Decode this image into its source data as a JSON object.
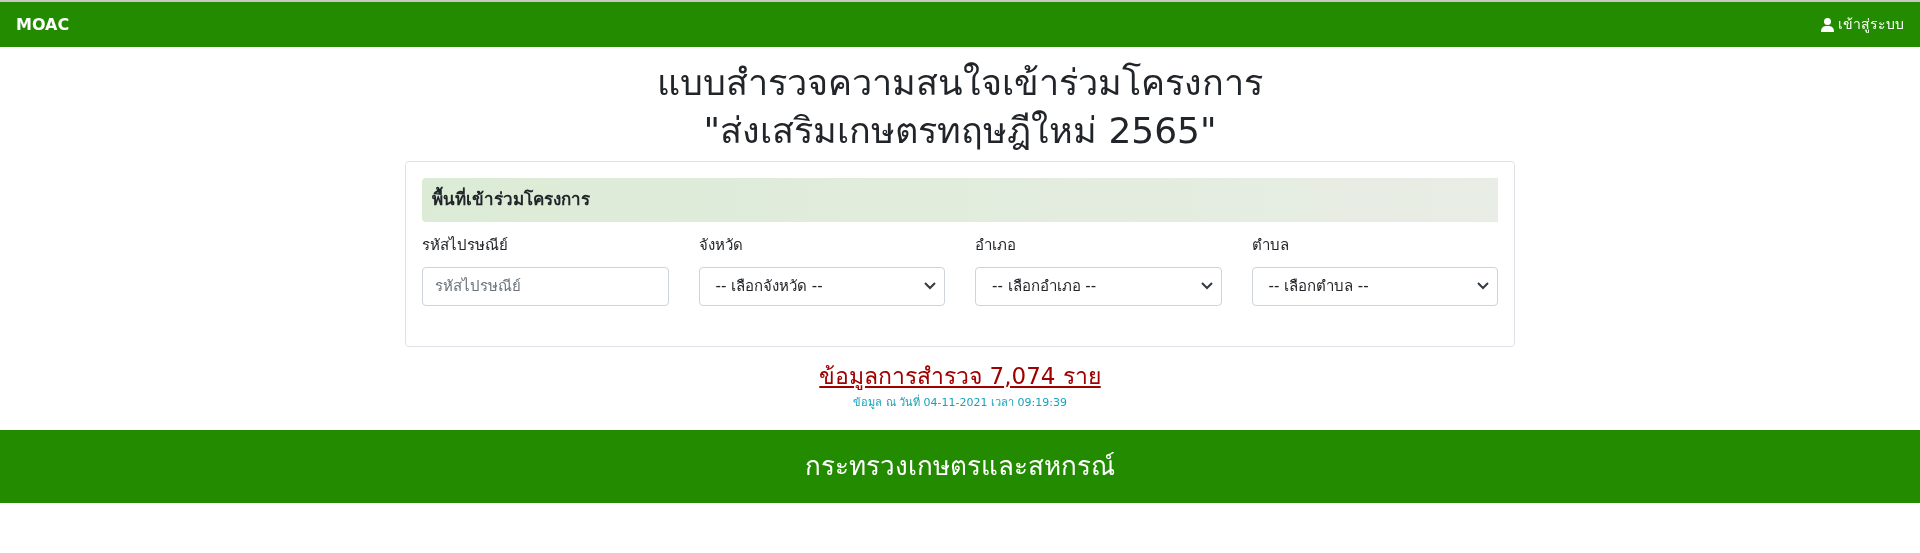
{
  "navbar": {
    "brand": "MOAC",
    "login": "เข้าสู่ระบบ"
  },
  "title_lines": [
    "แบบสำรวจความสนใจเข้าร่วมโครงการ",
    "\"ส่งเสริมเกษตรทฤษฎีใหม่ 2565\""
  ],
  "section": {
    "heading": "พื้นที่เข้าร่วมโครงการ",
    "fields": [
      {
        "kind": "input",
        "label": "รหัสไปรษณีย์",
        "placeholder": "รหัสไปรษณีย์"
      },
      {
        "kind": "select",
        "label": "จังหวัด",
        "value": "-- เลือกจังหวัด --"
      },
      {
        "kind": "select",
        "label": "อำเภอ",
        "value": "-- เลือกอำเภอ --"
      },
      {
        "kind": "select",
        "label": "ตำบล",
        "value": "-- เลือกตำบล --"
      }
    ]
  },
  "summary_link": "ข้อมูลการสำรวจ 7,074 ราย",
  "updated": "ข้อมูล ณ วันที่ 04-11-2021 เวลา 09:19:39",
  "footer": "กระทรวงเกษตรและสหกรณ์"
}
